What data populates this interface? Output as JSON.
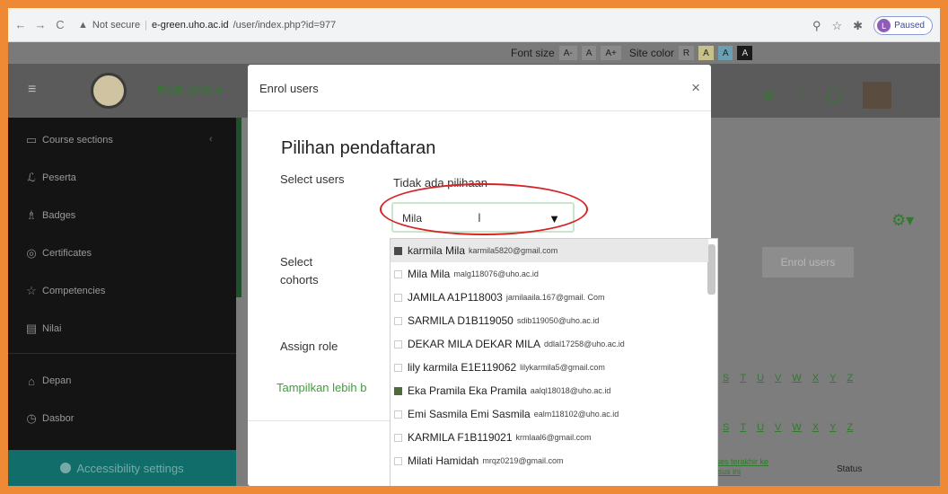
{
  "browser": {
    "nav_back": "←",
    "nav_forward": "→",
    "nav_reload": "C",
    "security_warning": "Not secure",
    "url_domain": "e-green.uho.ac.id",
    "url_path": "/user/index.php?id=977",
    "profile_initial": "L",
    "profile_status": "Paused"
  },
  "accessibility_bar": {
    "font_size_label": "Font size",
    "font_size_chips": [
      "A-",
      "A",
      "A+"
    ],
    "site_color_label": "Site color",
    "site_color_chips": [
      {
        "label": "R",
        "color": "#8a8a8a"
      },
      {
        "label": "A",
        "color": "#c5c08c"
      },
      {
        "label": "A",
        "color": "#6b9fb3"
      },
      {
        "label": "A",
        "color": "#1a1a1a"
      }
    ]
  },
  "navbar": {
    "menu_icon": "menu-icon",
    "site_name": "Profil UHO"
  },
  "sidebar": {
    "items": [
      {
        "label": "Course sections",
        "icon": "folder-icon"
      },
      {
        "label": "Peserta",
        "icon": "users-icon"
      },
      {
        "label": "Badges",
        "icon": "badge-icon"
      },
      {
        "label": "Certificates",
        "icon": "certificate-icon"
      },
      {
        "label": "Competencies",
        "icon": "competency-icon"
      },
      {
        "label": "Nilai",
        "icon": "grades-icon"
      },
      {
        "label": "Depan",
        "icon": "home-icon"
      },
      {
        "label": "Dasbor",
        "icon": "dashboard-icon"
      }
    ],
    "accessibility_button": "Accessibility settings"
  },
  "background_page": {
    "enrol_users_button": "Enrol users",
    "alphabet": [
      "S",
      "T",
      "U",
      "V",
      "W",
      "X",
      "Y",
      "Z"
    ],
    "last_access_header": "Akses terakhir ke kursus ini",
    "status_header": "Status"
  },
  "modal": {
    "title": "Enrol users",
    "close": "×",
    "heading": "Pilihan pendaftaran",
    "select_users_label": "Select users",
    "no_selection_text": "Tidak ada pilihaan",
    "search_value": "Mila",
    "select_cohorts_label": "Select cohorts",
    "assign_role_label": "Assign role",
    "show_more_link": "Tampilkan lebih b"
  },
  "dropdown_options": [
    {
      "name": "karmila Mila",
      "email": "karmila5820@gmail.com",
      "has_avatar": true
    },
    {
      "name": "Mila Mila",
      "email": "malg118076@uho.ac.id",
      "has_avatar": false
    },
    {
      "name": "JAMILA A1P118003",
      "email": "jamilaaila.167@gmail. Com",
      "has_avatar": false
    },
    {
      "name": "SARMILA D1B119050",
      "email": "sdib119050@uho.ac.id",
      "has_avatar": false
    },
    {
      "name": "DEKAR MILA DEKAR MILA",
      "email": "ddlal17258@uho.ac.id",
      "has_avatar": false
    },
    {
      "name": "lily karmila E1E119062",
      "email": "lilykarmila5@gmail.com",
      "has_avatar": false
    },
    {
      "name": "Eka Pramila Eka Pramila",
      "email": "aalql18018@uho.ac.id",
      "has_avatar": true
    },
    {
      "name": "Emi Sasmila Emi Sasmila",
      "email": "ealm118102@uho.ac.id",
      "has_avatar": false
    },
    {
      "name": "KARMILA F1B119021",
      "email": "krmlaal6@gmail.com",
      "has_avatar": false
    },
    {
      "name": "Milati Hamidah",
      "email": "mrqz0219@gmail.com",
      "has_avatar": false
    }
  ],
  "colors": {
    "border": "#ee8a36",
    "brand_green": "#3ea03a",
    "highlight_circle": "#d72323",
    "accessibility_teal": "#116d6a"
  }
}
